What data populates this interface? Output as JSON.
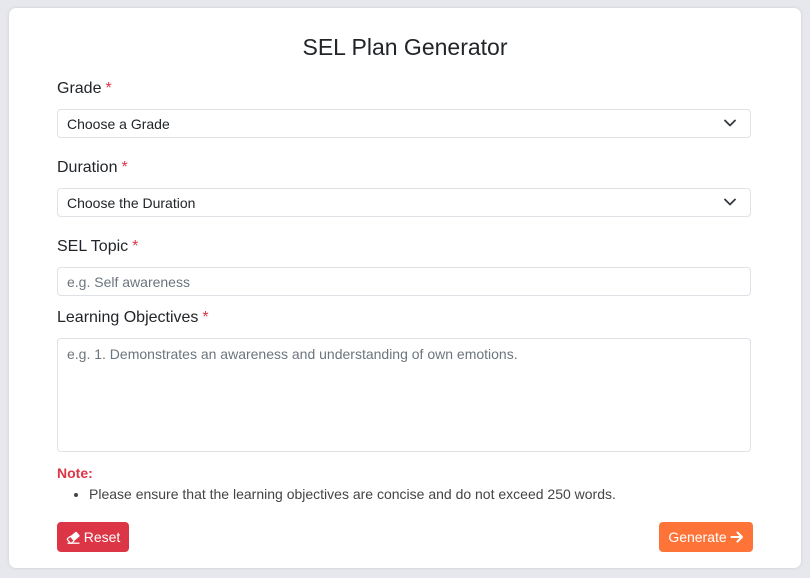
{
  "form": {
    "title": "SEL Plan Generator",
    "required_mark": "*",
    "grade": {
      "label": "Grade",
      "selected": "Choose a Grade"
    },
    "duration": {
      "label": "Duration",
      "selected": "Choose the Duration"
    },
    "topic": {
      "label": "SEL Topic",
      "value": "",
      "placeholder": "e.g. Self awareness"
    },
    "objectives": {
      "label": "Learning Objectives",
      "value": "",
      "placeholder": "e.g. 1. Demonstrates an awareness and understanding of own emotions."
    },
    "note": {
      "title": "Note:",
      "items": [
        "Please ensure that the learning objectives are concise and do not exceed 250 words."
      ]
    },
    "buttons": {
      "reset_label": "Reset",
      "reset_icon": "eraser-icon",
      "generate_label": "Generate",
      "generate_icon": "arrow-right-icon"
    }
  },
  "colors": {
    "required": "#dc3545",
    "reset_button": "#dc3545",
    "generate_button": "#fd7338",
    "note_title": "#dc3545"
  }
}
